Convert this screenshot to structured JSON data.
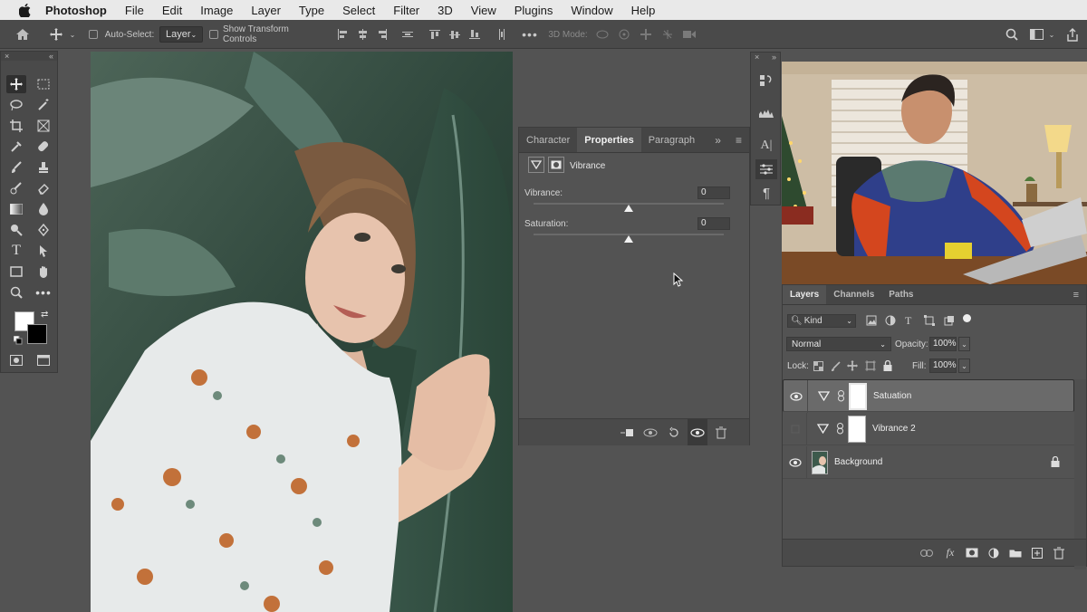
{
  "menubar": {
    "app_name": "Photoshop",
    "items": [
      "File",
      "Edit",
      "Image",
      "Layer",
      "Type",
      "Select",
      "Filter",
      "3D",
      "View",
      "Plugins",
      "Window",
      "Help"
    ]
  },
  "options_bar": {
    "auto_select_label": "Auto-Select:",
    "auto_select_value": "Layer",
    "transform_label": "Show Transform Controls",
    "mode_3d_label": "3D Mode:"
  },
  "properties": {
    "tabs": [
      "Character",
      "Properties",
      "Paragraph"
    ],
    "active_tab": "Properties",
    "adjustment_title": "Vibrance",
    "vibrance_label": "Vibrance:",
    "vibrance_value": "0",
    "saturation_label": "Saturation:",
    "saturation_value": "0",
    "vibrance_level": 0,
    "saturation_level": 0
  },
  "layers": {
    "tabs": [
      "Layers",
      "Channels",
      "Paths"
    ],
    "active_tab": "Layers",
    "filter_kind": "Kind",
    "blend_mode": "Normal",
    "opacity_label": "Opacity:",
    "opacity_value": "100%",
    "lock_label": "Lock:",
    "fill_label": "Fill:",
    "fill_value": "100%",
    "rows": [
      {
        "name": "Satuation",
        "visible": true,
        "selected": true
      },
      {
        "name": "Vibrance 2",
        "visible": false,
        "selected": false
      },
      {
        "name": "Background",
        "visible": true,
        "selected": false
      }
    ]
  },
  "colors": {
    "panel_bg": "#535353",
    "panel_dark": "#4a4a4a",
    "menubar_bg": "#e9e9e9",
    "selected_row": "#6a6a6a"
  }
}
